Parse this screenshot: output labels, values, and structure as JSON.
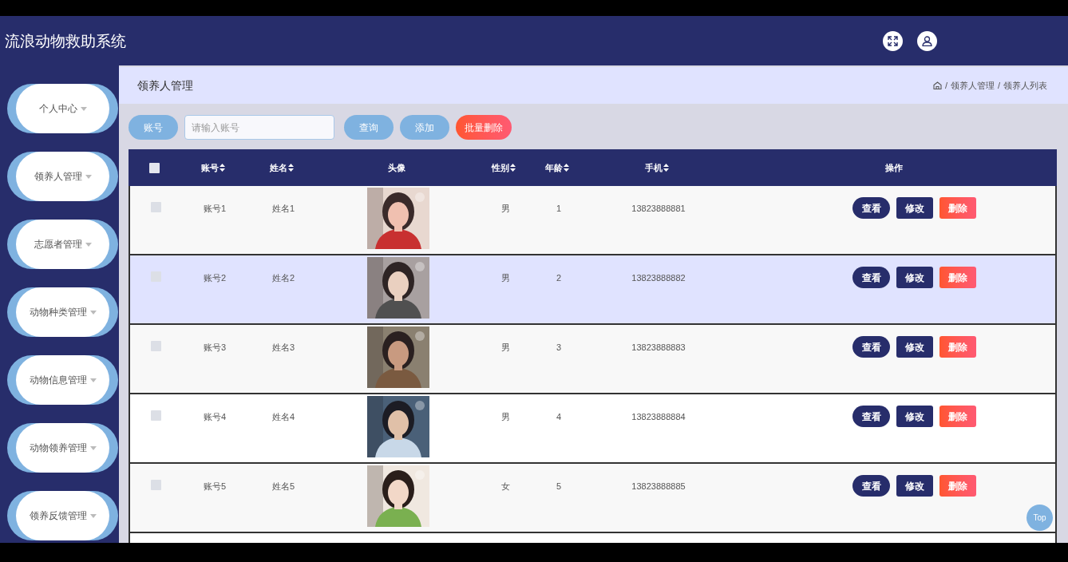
{
  "app_title": "流浪动物救助系统",
  "sidebar": {
    "items": [
      {
        "label": "个人中心",
        "selected": false
      },
      {
        "label": "领养人管理",
        "selected": false
      },
      {
        "label": "志愿者管理",
        "selected": false
      },
      {
        "label": "动物种类管理",
        "selected": false
      },
      {
        "label": "动物信息管理",
        "selected": false
      },
      {
        "label": "动物领养管理",
        "selected": false
      },
      {
        "label": "领养反馈管理",
        "selected": false
      }
    ]
  },
  "page_title": "领养人管理",
  "breadcrumb": [
    "领养人管理",
    "领养人列表"
  ],
  "breadcrumb_separator": "/",
  "search": {
    "label": "账号",
    "placeholder": "请输入账号"
  },
  "buttons": [
    {
      "label": "查询",
      "kind": "primary"
    },
    {
      "label": "添加",
      "kind": "primary"
    },
    {
      "label": "批量删除",
      "kind": "danger"
    }
  ],
  "table": {
    "select_all": {
      "checked": false
    },
    "columns": [
      {
        "label": "账号",
        "sortable": true
      },
      {
        "label": "姓名",
        "sortable": true
      },
      {
        "label": "头像",
        "sortable": false
      },
      {
        "label": "性别",
        "sortable": true
      },
      {
        "label": "年龄",
        "sortable": true
      },
      {
        "label": "手机",
        "sortable": true
      },
      {
        "label": "操作",
        "sortable": false
      }
    ],
    "rows": [
      {
        "checked": false,
        "highlighted": false,
        "account": "账号1",
        "name": "姓名1",
        "gender": "男",
        "age": "1",
        "phone": "13823888881",
        "actions": [
          "查看",
          "修改",
          "删除"
        ]
      },
      {
        "checked": false,
        "highlighted": true,
        "account": "账号2",
        "name": "姓名2",
        "gender": "男",
        "age": "2",
        "phone": "13823888882",
        "actions": [
          "查看",
          "修改",
          "删除"
        ]
      },
      {
        "checked": false,
        "highlighted": false,
        "account": "账号3",
        "name": "姓名3",
        "gender": "男",
        "age": "3",
        "phone": "13823888883",
        "actions": [
          "查看",
          "修改",
          "删除"
        ]
      },
      {
        "checked": false,
        "highlighted": false,
        "account": "账号4",
        "name": "姓名4",
        "gender": "男",
        "age": "4",
        "phone": "13823888884",
        "actions": [
          "查看",
          "修改",
          "删除"
        ]
      },
      {
        "checked": false,
        "highlighted": false,
        "account": "账号5",
        "name": "姓名5",
        "gender": "女",
        "age": "5",
        "phone": "13823888885",
        "actions": [
          "查看",
          "修改",
          "删除"
        ]
      }
    ]
  },
  "back_to_top": "Top"
}
